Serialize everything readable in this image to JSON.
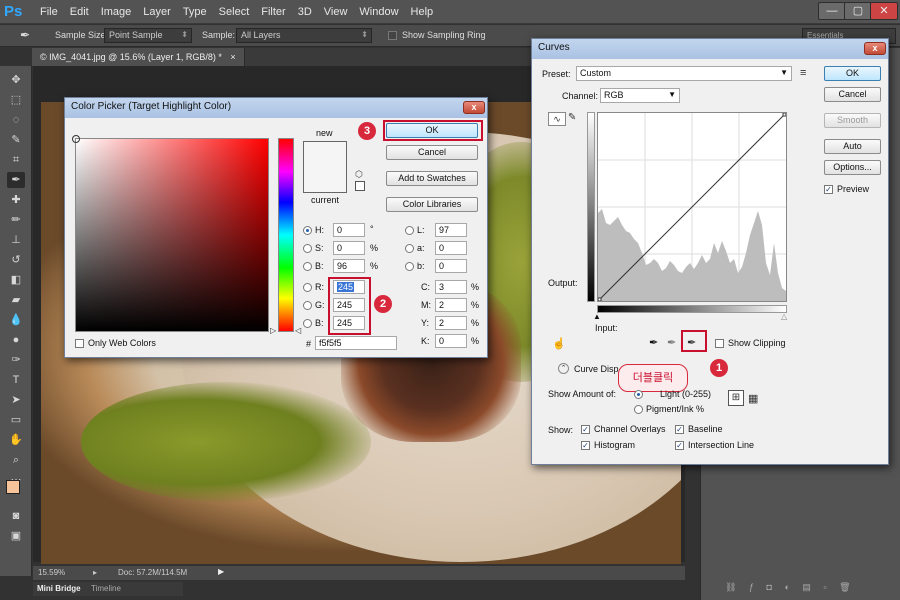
{
  "app": {
    "logo": "Ps",
    "menu": [
      "File",
      "Edit",
      "Image",
      "Layer",
      "Type",
      "Select",
      "Filter",
      "3D",
      "View",
      "Window",
      "Help"
    ],
    "window_controls": [
      "—",
      "▢",
      "✕"
    ]
  },
  "options_bar": {
    "sample_size_label": "Sample Size:",
    "sample_size_value": "Point Sample",
    "sample_label": "Sample:",
    "sample_value": "All Layers",
    "show_ring_label": "Show Sampling Ring",
    "workspace": "Essentials"
  },
  "document": {
    "tab_label": "© IMG_4041.jpg @ 15.6% (Layer 1, RGB/8) *",
    "tab_close": "×",
    "zoom": "15.59%",
    "doc_info": "Doc: 57.2M/114.5M",
    "bottom_tabs": [
      "Mini Bridge",
      "Timeline"
    ]
  },
  "color_picker": {
    "title": "Color Picker (Target Highlight Color)",
    "new_label": "new",
    "current_label": "current",
    "buttons": {
      "ok": "OK",
      "cancel": "Cancel",
      "add_swatches": "Add to Swatches",
      "libraries": "Color Libraries"
    },
    "hsb": {
      "h_label": "H:",
      "h": "0",
      "h_unit": "°",
      "s_label": "S:",
      "s": "0",
      "s_unit": "%",
      "b_label": "B:",
      "b": "96",
      "b_unit": "%"
    },
    "rgb": {
      "r_label": "R:",
      "r": "245",
      "g_label": "G:",
      "g": "245",
      "b_label": "B:",
      "b": "245"
    },
    "lab": {
      "l_label": "L:",
      "l": "97",
      "a_label": "a:",
      "a": "0",
      "b_label": "b:",
      "b": "0"
    },
    "cmyk": {
      "c_label": "C:",
      "c": "3",
      "m_label": "M:",
      "m": "2",
      "y_label": "Y:",
      "y": "2",
      "k_label": "K:",
      "k": "0",
      "unit": "%"
    },
    "hex_label": "#",
    "hex": "f5f5f5",
    "only_web_label": "Only Web Colors",
    "color": "#f5f5f5"
  },
  "curves": {
    "title": "Curves",
    "preset_label": "Preset:",
    "preset_value": "Custom",
    "channel_label": "Channel:",
    "channel_value": "RGB",
    "output_label": "Output:",
    "input_label": "Input:",
    "buttons": {
      "ok": "OK",
      "cancel": "Cancel",
      "smooth": "Smooth",
      "auto": "Auto",
      "options": "Options..."
    },
    "preview_label": "Preview",
    "show_clipping_label": "Show Clipping",
    "curve_display_label": "Curve Disp",
    "show_amount_label": "Show Amount of:",
    "light_label": "Light  (0-255)",
    "pigment_label": "Pigment/Ink %",
    "show_label": "Show:",
    "channel_overlays_label": "Channel Overlays",
    "baseline_label": "Baseline",
    "histogram_label": "Histogram",
    "intersection_label": "Intersection Line"
  },
  "annotations": {
    "step1": "1",
    "step2": "2",
    "step3": "3",
    "callout": "더블클릭",
    "highlight_color": "#c8102e"
  }
}
